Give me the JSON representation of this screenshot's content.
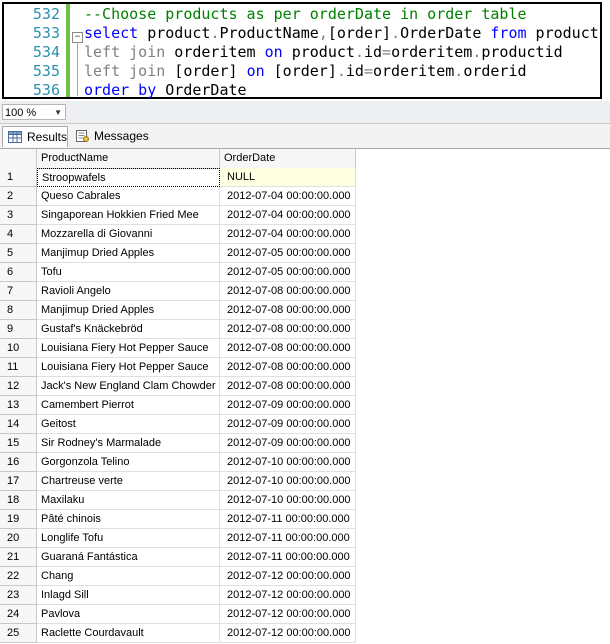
{
  "editor": {
    "lines": [
      {
        "num": "532",
        "tokens": [
          {
            "t": "--Choose products as per orderDate in order table",
            "c": "cmt"
          }
        ]
      },
      {
        "num": "533",
        "tokens": [
          {
            "t": "select",
            "c": "kw"
          },
          {
            "t": " product",
            "c": "tx"
          },
          {
            "t": ".",
            "c": "gr"
          },
          {
            "t": "ProductName",
            "c": "tx"
          },
          {
            "t": ",",
            "c": "gr"
          },
          {
            "t": "[order]",
            "c": "tx"
          },
          {
            "t": ".",
            "c": "gr"
          },
          {
            "t": "OrderDate ",
            "c": "tx"
          },
          {
            "t": "from",
            "c": "kw"
          },
          {
            "t": " product",
            "c": "tx"
          }
        ]
      },
      {
        "num": "534",
        "tokens": [
          {
            "t": "left join",
            "c": "gr"
          },
          {
            "t": " orderitem ",
            "c": "tx"
          },
          {
            "t": "on",
            "c": "kw"
          },
          {
            "t": " product",
            "c": "tx"
          },
          {
            "t": ".",
            "c": "gr"
          },
          {
            "t": "id",
            "c": "tx"
          },
          {
            "t": "=",
            "c": "gr"
          },
          {
            "t": "orderitem",
            "c": "tx"
          },
          {
            "t": ".",
            "c": "gr"
          },
          {
            "t": "productid",
            "c": "tx"
          }
        ]
      },
      {
        "num": "535",
        "tokens": [
          {
            "t": "left join",
            "c": "gr"
          },
          {
            "t": " [order] ",
            "c": "tx"
          },
          {
            "t": "on",
            "c": "kw"
          },
          {
            "t": " [order]",
            "c": "tx"
          },
          {
            "t": ".",
            "c": "gr"
          },
          {
            "t": "id",
            "c": "tx"
          },
          {
            "t": "=",
            "c": "gr"
          },
          {
            "t": "orderitem",
            "c": "tx"
          },
          {
            "t": ".",
            "c": "gr"
          },
          {
            "t": "orderid",
            "c": "tx"
          }
        ]
      },
      {
        "num": "536",
        "tokens": [
          {
            "t": "order by",
            "c": "kw"
          },
          {
            "t": " OrderDate",
            "c": "tx"
          }
        ]
      }
    ],
    "outline_symbol": "−"
  },
  "zoom": {
    "value": "100 %",
    "arrow": "▼"
  },
  "tabs": [
    {
      "label": "Results",
      "icon": "grid-icon",
      "active": true
    },
    {
      "label": "Messages",
      "icon": "messages-icon",
      "active": false
    }
  ],
  "grid": {
    "columns": [
      "ProductName",
      "OrderDate"
    ],
    "rows": [
      [
        "1",
        "Stroopwafels",
        "NULL"
      ],
      [
        "2",
        "Queso Cabrales",
        "2012-07-04 00:00:00.000"
      ],
      [
        "3",
        "Singaporean Hokkien Fried Mee",
        "2012-07-04 00:00:00.000"
      ],
      [
        "4",
        "Mozzarella di Giovanni",
        "2012-07-04 00:00:00.000"
      ],
      [
        "5",
        "Manjimup Dried Apples",
        "2012-07-05 00:00:00.000"
      ],
      [
        "6",
        "Tofu",
        "2012-07-05 00:00:00.000"
      ],
      [
        "7",
        "Ravioli Angelo",
        "2012-07-08 00:00:00.000"
      ],
      [
        "8",
        "Manjimup Dried Apples",
        "2012-07-08 00:00:00.000"
      ],
      [
        "9",
        "Gustaf's Knäckebröd",
        "2012-07-08 00:00:00.000"
      ],
      [
        "10",
        "Louisiana Fiery Hot Pepper Sauce",
        "2012-07-08 00:00:00.000"
      ],
      [
        "11",
        "Louisiana Fiery Hot Pepper Sauce",
        "2012-07-08 00:00:00.000"
      ],
      [
        "12",
        "Jack's New England Clam Chowder",
        "2012-07-08 00:00:00.000"
      ],
      [
        "13",
        "Camembert Pierrot",
        "2012-07-09 00:00:00.000"
      ],
      [
        "14",
        "Geitost",
        "2012-07-09 00:00:00.000"
      ],
      [
        "15",
        "Sir Rodney's Marmalade",
        "2012-07-09 00:00:00.000"
      ],
      [
        "16",
        "Gorgonzola Telino",
        "2012-07-10 00:00:00.000"
      ],
      [
        "17",
        "Chartreuse verte",
        "2012-07-10 00:00:00.000"
      ],
      [
        "18",
        "Maxilaku",
        "2012-07-10 00:00:00.000"
      ],
      [
        "19",
        "Pâté chinois",
        "2012-07-11 00:00:00.000"
      ],
      [
        "20",
        "Longlife Tofu",
        "2012-07-11 00:00:00.000"
      ],
      [
        "21",
        "Guaraná Fantástica",
        "2012-07-11 00:00:00.000"
      ],
      [
        "22",
        "Chang",
        "2012-07-12 00:00:00.000"
      ],
      [
        "23",
        "Inlagd Sill",
        "2012-07-12 00:00:00.000"
      ],
      [
        "24",
        "Pavlova",
        "2012-07-12 00:00:00.000"
      ],
      [
        "25",
        "Raclette Courdavault",
        "2012-07-12 00:00:00.000"
      ]
    ]
  },
  "colors": {
    "comment": "#008000",
    "keyword": "#0000ff",
    "operator": "#808080",
    "line_number": "#2b91af",
    "change_bar": "#6cc24a",
    "null_cell": "#ffffe1"
  }
}
